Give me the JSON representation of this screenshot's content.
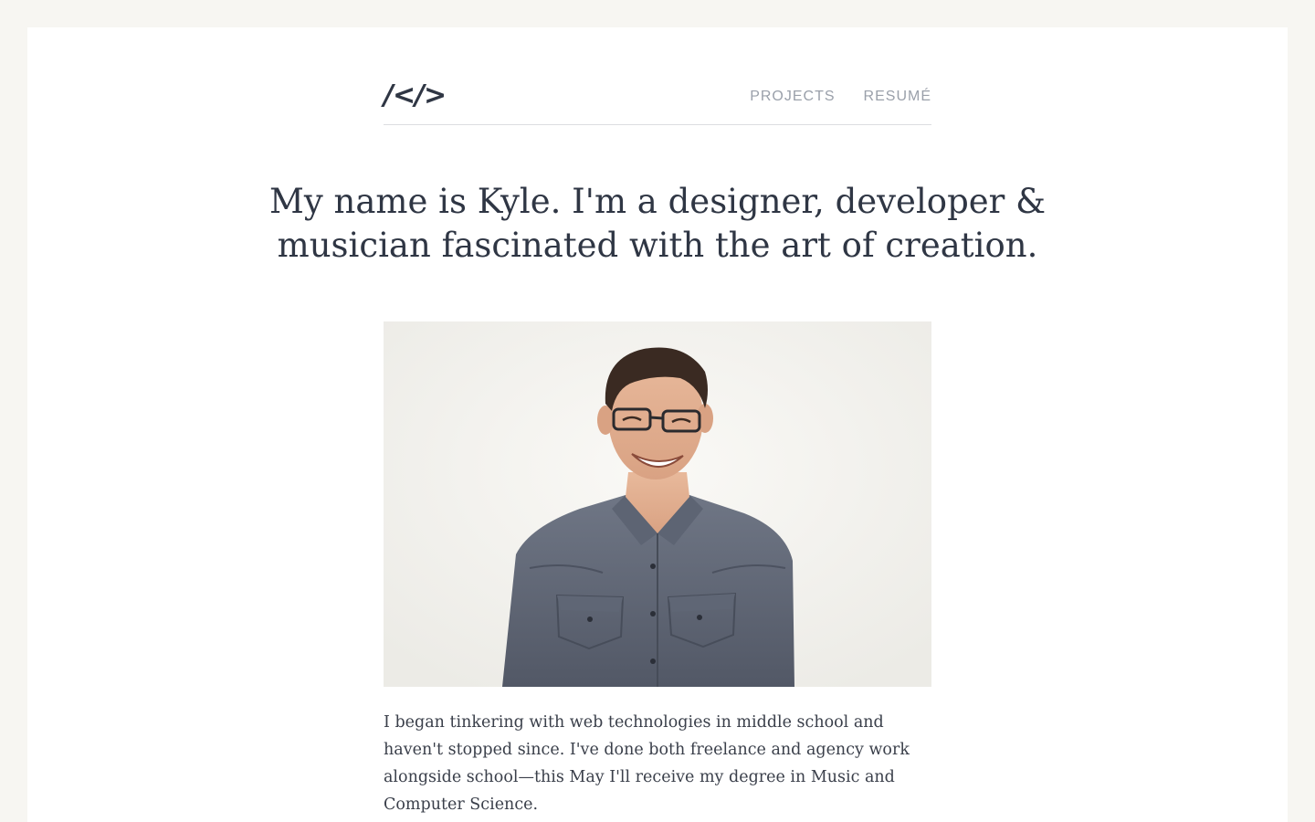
{
  "header": {
    "logo_text": "/</>",
    "nav": {
      "projects_label": "PROJECTS",
      "resume_label": "RESUMÉ"
    }
  },
  "hero": {
    "headline": "My name is Kyle. I'm a designer, developer & musician fascinated with the art of creation."
  },
  "about": {
    "photo_subject": "portrait-photo",
    "bio": "I began tinkering with web technologies in middle school and haven't stopped since. I've done both freelance and agency work alongside school—this May I'll receive my degree in Music and Computer Science."
  },
  "colors": {
    "background": "#f7f6f2",
    "text": "#2f3644",
    "nav_text": "#9aa0aa"
  }
}
